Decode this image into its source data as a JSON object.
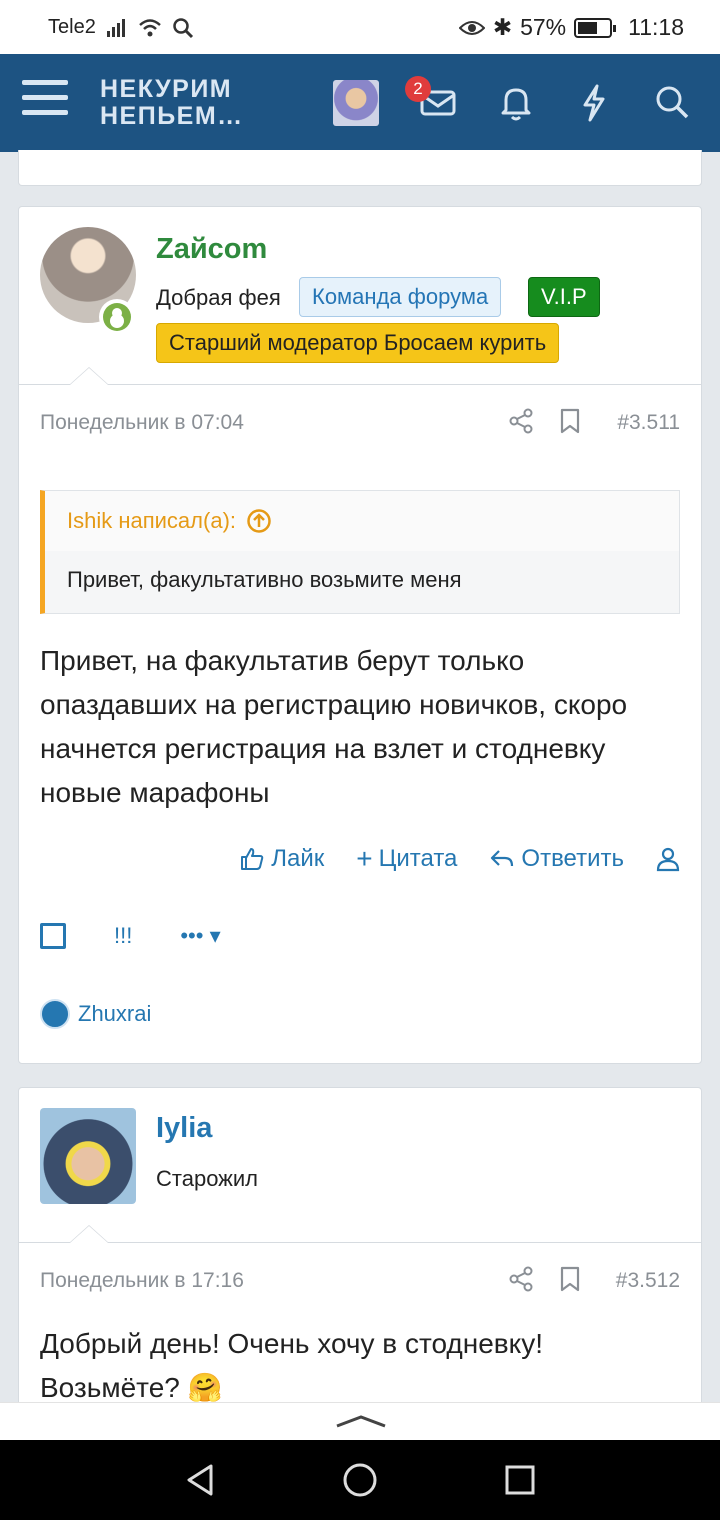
{
  "status_bar": {
    "carrier": "Tele2",
    "battery": "57%",
    "time": "11:18"
  },
  "header": {
    "logo_line1": "НЕКУРИМ",
    "logo_line2": "НЕПЬЕМ…",
    "messages_badge": "2"
  },
  "posts": [
    {
      "author": "Zайсom",
      "author_color": "#2f8a3d",
      "user_title": "Добрая фея",
      "tags": [
        "Команда форума",
        "V.I.P",
        "Старший модератор Бросаем курить"
      ],
      "date": "Понедельник в 07:04",
      "number": "#3.511",
      "quote": {
        "head": "Ishik написал(а):",
        "text": "Привет, факультативно возьмите меня"
      },
      "text": "Привет, на факультатив берут только опаздавших на регистрацию новичков, скоро начнется регистрация на взлет и стодневку новые марафоны",
      "actions": {
        "like": "Лайк",
        "quote": "Цитата",
        "reply": "Ответить"
      },
      "tools": {
        "flag": "!!!"
      },
      "liked_by": "Zhuxrai"
    },
    {
      "author": "Iylia",
      "author_color": "#2577b1",
      "user_title": "Старожил",
      "date": "Понедельник в 17:16",
      "number": "#3.512",
      "text": "Добрый день! Очень хочу в стодневку! Возьмёте? 🤗"
    }
  ]
}
